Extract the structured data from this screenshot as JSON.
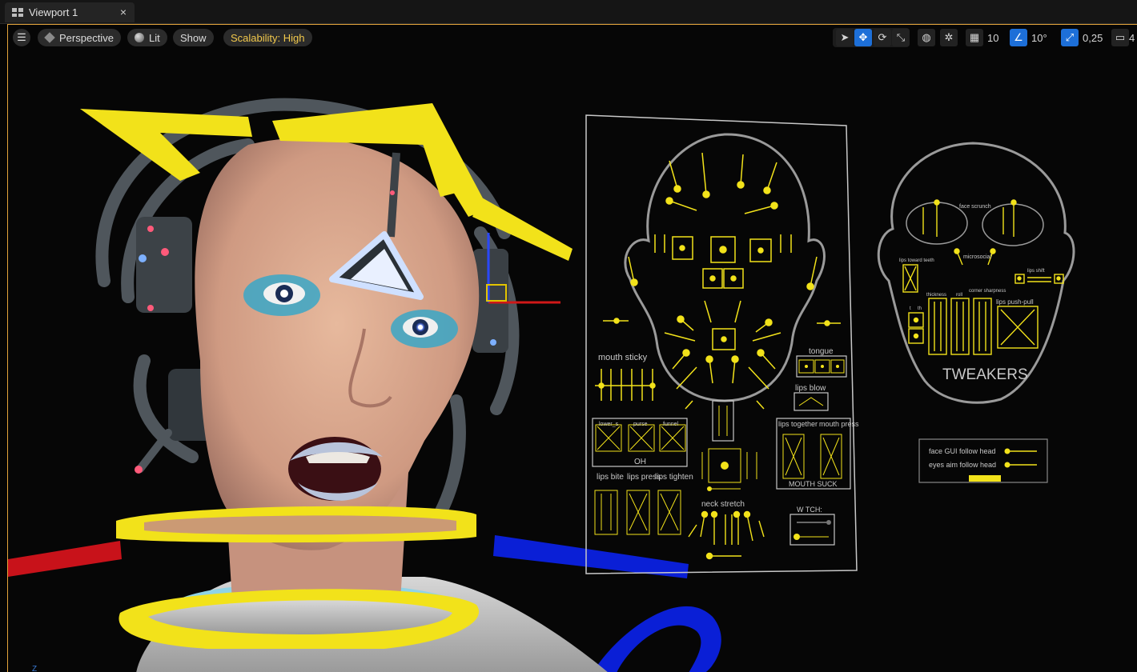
{
  "tab": {
    "title": "Viewport 1",
    "close": "×"
  },
  "toolbar": {
    "menu_icon": "hamburger-icon",
    "perspective": "Perspective",
    "lit": "Lit",
    "show": "Show",
    "scalability": "Scalability: High",
    "grid_snap": "10",
    "angle_snap": "10°",
    "scale_snap": "0,25",
    "camera_speed": "4"
  },
  "face_gui": {
    "mouth_sticky": "mouth sticky",
    "tongue": "tongue",
    "lips_blow": "lips blow",
    "lower_s": "lower_s",
    "purse": "purse",
    "funnel": "funnel",
    "oh": "OH",
    "lips_together": "lips together",
    "mouth_press": "mouth press",
    "mouth_suck": "MOUTH SUCK",
    "lips_bite": "lips bite",
    "lips_press": "lips press",
    "lips_tighten": "lips tighten",
    "neck_stretch": "neck stretch",
    "watch": "W TCH:"
  },
  "tweakers": {
    "title": "TWEAKERS",
    "face_scrunch": "face scrunch",
    "microsocial": "microsocial",
    "lips_toward_teeth": "lips toward teeth",
    "lips_shift": "lips shift",
    "thickness": "thickness",
    "roll": "roll",
    "corner_sharpness": "corner sharpness",
    "lips_push_pull": "lips push-pull",
    "t": "t",
    "th": "th"
  },
  "follow_panel": {
    "face_gui_follow": "face GUI follow head",
    "eyes_aim_follow": "eyes aim follow head"
  },
  "axis_label": "Z",
  "colors": {
    "accent": "#1d6fd8",
    "ctrl_yellow": "#f2e21a",
    "border": "#e3a43a",
    "blue_ctrl": "#0a1fd6",
    "red_ctrl": "#c8121a"
  }
}
